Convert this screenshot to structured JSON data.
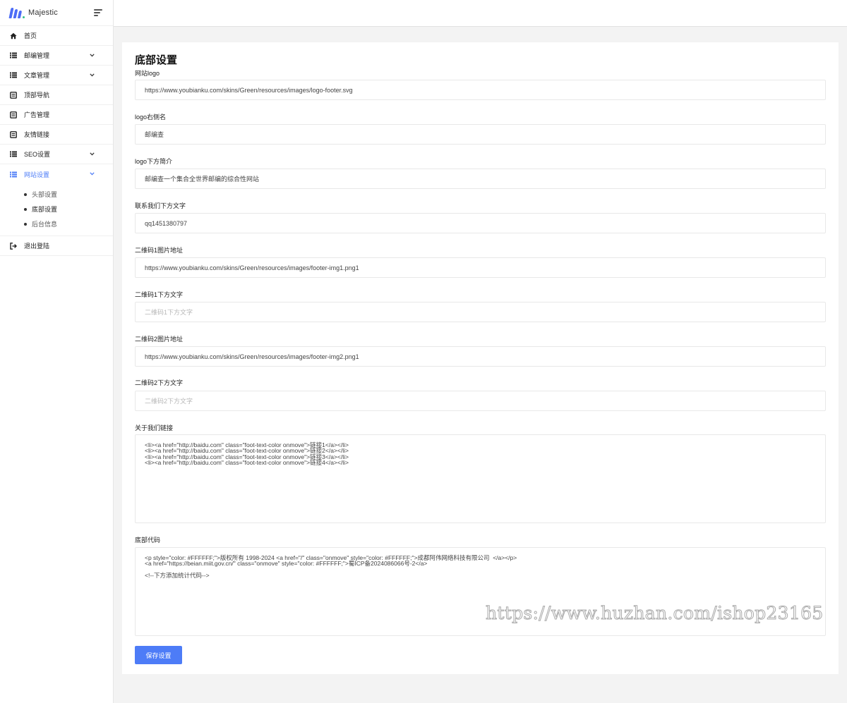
{
  "app": {
    "name": "Majestic"
  },
  "sidebar": {
    "items": [
      {
        "label": "首页"
      },
      {
        "label": "邮编管理"
      },
      {
        "label": "文章管理"
      },
      {
        "label": "顶部导航"
      },
      {
        "label": "广告管理"
      },
      {
        "label": "友情链接"
      },
      {
        "label": "SEO设置"
      },
      {
        "label": "网站设置"
      },
      {
        "label": "退出登陆"
      }
    ],
    "subitems": [
      {
        "label": "头部设置"
      },
      {
        "label": "底部设置"
      },
      {
        "label": "后台信息"
      }
    ]
  },
  "form": {
    "title": "底部设置",
    "fields": [
      {
        "label": "网站logo",
        "value": "https://www.youbianku.com/skins/Green/resources/images/logo-footer.svg",
        "placeholder": ""
      },
      {
        "label": "logo右侧名",
        "value": "邮编查",
        "placeholder": ""
      },
      {
        "label": "logo下方简介",
        "value": "邮编查一个集合全世界邮编的综合性网站",
        "placeholder": ""
      },
      {
        "label": "联系我们下方文字",
        "value": "qq1451380797",
        "placeholder": ""
      },
      {
        "label": "二维码1图片地址",
        "value": "https://www.youbianku.com/skins/Green/resources/images/footer-img1.png1",
        "placeholder": ""
      },
      {
        "label": "二维码1下方文字",
        "value": "",
        "placeholder": "二维码1下方文字"
      },
      {
        "label": "二维码2图片地址",
        "value": "https://www.youbianku.com/skins/Green/resources/images/footer-img2.png1",
        "placeholder": ""
      },
      {
        "label": "二维码2下方文字",
        "value": "",
        "placeholder": "二维码2下方文字"
      }
    ],
    "about_label": "关于我们链接",
    "about_value": "<li><a href=\"http://baidu.com\" class=\"foot-text-color onmove\">链接1</a></li>\n<li><a href=\"http://baidu.com\" class=\"foot-text-color onmove\">链接2</a></li>\n<li><a href=\"http://baidu.com\" class=\"foot-text-color onmove\">链接3</a></li>\n<li><a href=\"http://baidu.com\" class=\"foot-text-color onmove\">链接4</a></li>",
    "footer_label": "底部代码",
    "footer_value": "<p style=\"color: #FFFFFF;\">版权所有 1998-2024 <a href=\"/\" class=\"onmove\" style=\"color: #FFFFFF;\">成都阿伟网络科技有限公司  </a></p>\n<a href=\"https://beian.miit.gov.cn/\" class=\"onmove\" style=\"color: #FFFFFF;\">蜀ICP备2024086066号-2</a>\n\n<!--下方添加统计代码-->",
    "save_label": "保存设置"
  },
  "watermark": "https://www.huzhan.com/ishop23165",
  "colors": {
    "accent": "#4d7cf7",
    "logo_blue": "#4d6df6",
    "logo_dot": "#34be8a"
  },
  "icons": {
    "home": "home-icon",
    "list": "list-icon",
    "document": "document-icon",
    "logout": "logout-icon",
    "chevron": "chevron-down-icon",
    "menu": "menu-icon"
  }
}
